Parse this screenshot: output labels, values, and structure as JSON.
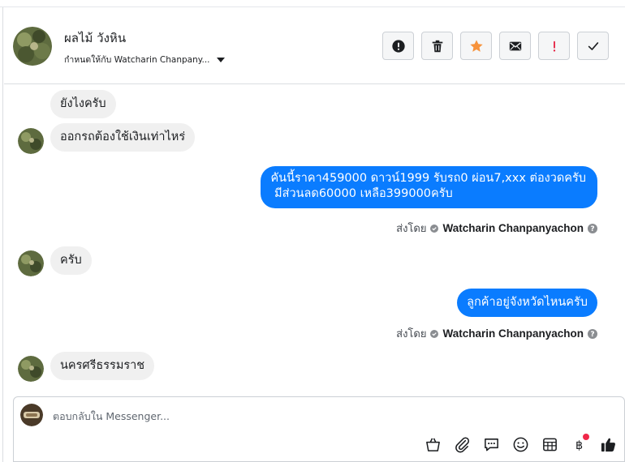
{
  "header": {
    "contact_name": "ผลไม้ วังหิน",
    "assign_text": "กำหนดให้กับ Watcharin Chanpany...",
    "actions": [
      {
        "name": "report-spam-button",
        "icon": "alert-circle-icon"
      },
      {
        "name": "delete-button",
        "icon": "trash-icon"
      },
      {
        "name": "star-button",
        "icon": "star-icon"
      },
      {
        "name": "mark-unread-button",
        "icon": "envelope-icon"
      },
      {
        "name": "follow-up-button",
        "icon": "exclamation-icon"
      },
      {
        "name": "mark-done-button",
        "icon": "checkmark-icon"
      }
    ]
  },
  "messages": [
    {
      "from": "customer",
      "text": "ยังไงครับ"
    },
    {
      "from": "customer",
      "text": "ออกรถต้องใช้เงินเท่าไหร่"
    },
    {
      "from": "page",
      "lines": [
        "คันนี้ราคา459000 ดาวน์1999  รับรถ0 ผ่อน7,xxx ต่องวดครับ",
        " มีส่วนลด60000 เหลือ399000ครับ"
      ]
    },
    {
      "from": "customer",
      "text": "ครับ"
    },
    {
      "from": "page",
      "text": "ลูกค้าอยู่จังหวัดไหนครับ"
    },
    {
      "from": "customer",
      "text": "นครศรีธรรมราช"
    }
  ],
  "sent_by": {
    "label": "ส่งโดย",
    "agent": "Watcharin Chanpanyachon"
  },
  "composer": {
    "placeholder": "ตอบกลับใน Messenger..."
  },
  "colors": {
    "outgoing_bubble": "#0a7cff",
    "incoming_bubble": "#f0f0f0",
    "star": "#f7923b",
    "follow_up": "#e41e3f",
    "notification_dot": "#f02849"
  }
}
